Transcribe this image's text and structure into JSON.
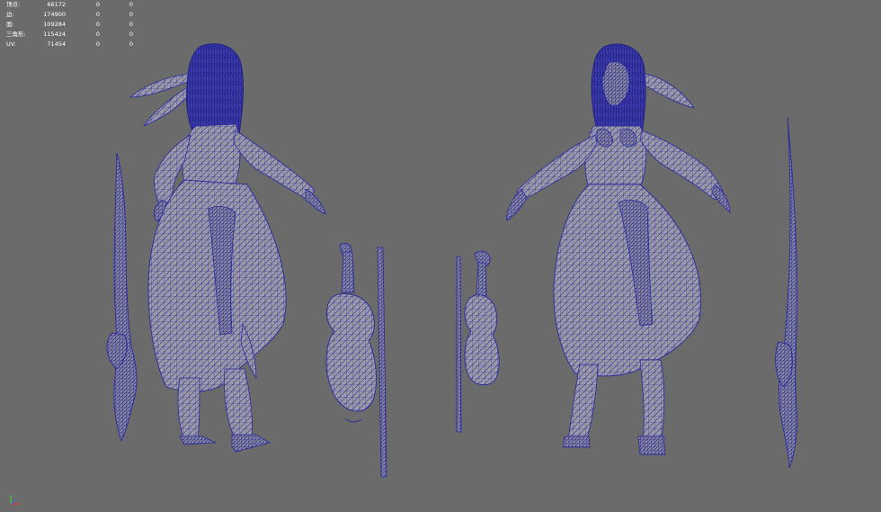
{
  "hud": {
    "rows": [
      {
        "label": "顶点:",
        "values": [
          "66172",
          "0",
          "0"
        ]
      },
      {
        "label": "边:",
        "values": [
          "174900",
          "0",
          "0"
        ]
      },
      {
        "label": "面:",
        "values": [
          "109284",
          "0",
          "0"
        ]
      },
      {
        "label": "三角形:",
        "values": [
          "115424",
          "0",
          "0"
        ]
      },
      {
        "label": "UV:",
        "values": [
          "71454",
          "0",
          "0"
        ]
      }
    ]
  },
  "colors": {
    "background": "#6b6b6b",
    "mesh_fill": "#9b9aa6",
    "wire": "#2a2a9c",
    "hud_text": "#ffffff"
  },
  "icons": {
    "axis_gizmo": "axis-gizmo-icon"
  }
}
